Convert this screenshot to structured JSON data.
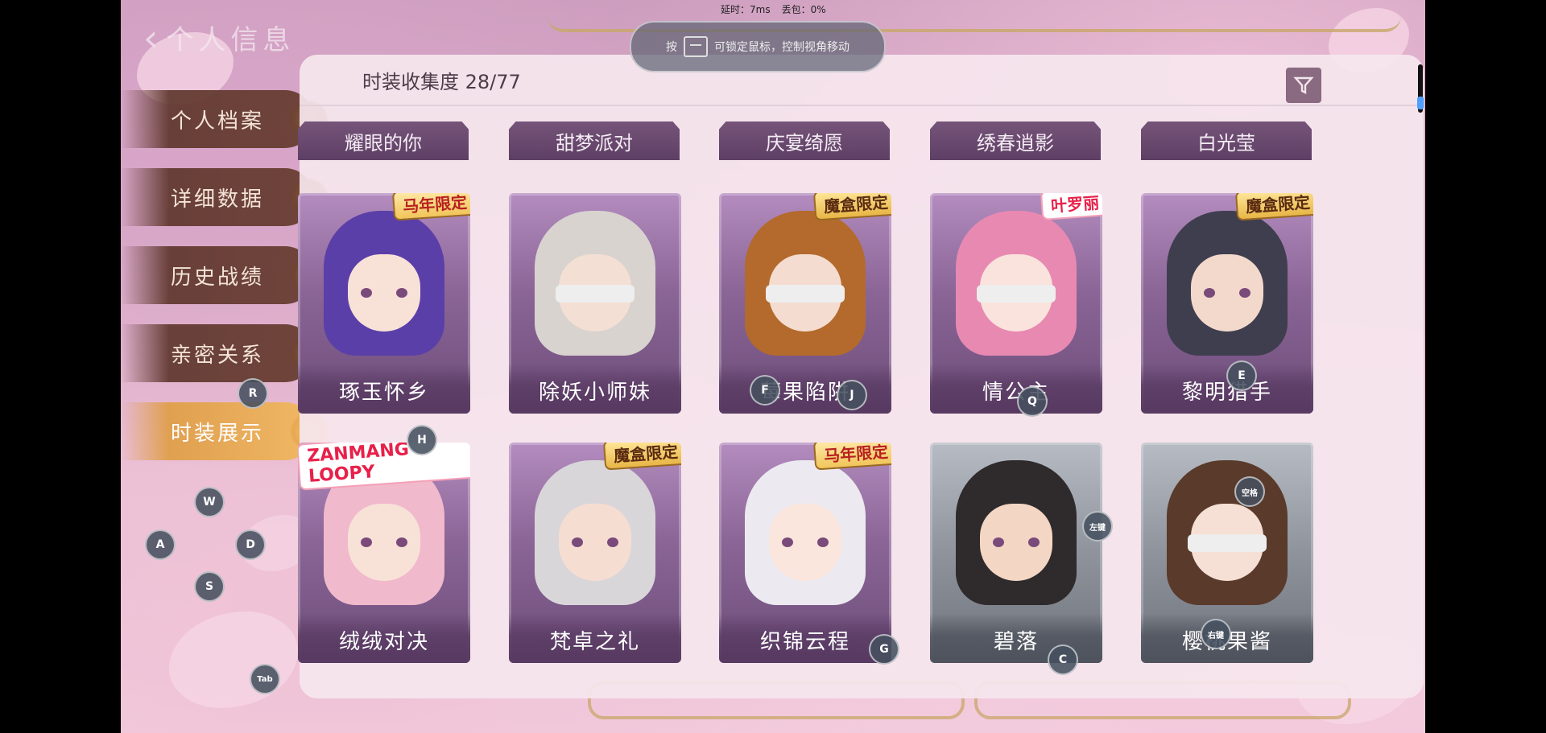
{
  "header": {
    "back_title": "个人信息",
    "net_latency": "延时：7ms",
    "net_loss": "丢包：0%",
    "hint_prefix": "按",
    "hint_text": "可锁定鼠标，控制视角移动"
  },
  "sidebar": {
    "items": [
      {
        "label": "个人档案"
      },
      {
        "label": "详细数据"
      },
      {
        "label": "历史战绩"
      },
      {
        "label": "亲密关系"
      },
      {
        "label": "时装展示",
        "active": true
      }
    ]
  },
  "panel": {
    "collection_label": "时装收集度",
    "collection_value": "28/77",
    "tabs": [
      "耀眼的你",
      "甜梦派对",
      "庆宴绮愿",
      "绣春逍影",
      "白光莹"
    ]
  },
  "costumes": [
    {
      "name": "琢玉怀乡",
      "badge": "马年限定",
      "badge_style": "red",
      "hair": "#5b3fa8",
      "skin": "#f8e2d8"
    },
    {
      "name": "除妖小师妹",
      "badge": "",
      "badge_style": "",
      "hair": "#d8d3cf",
      "skin": "#f4dfd4",
      "blindfold": true
    },
    {
      "name": "莓果陷阱",
      "badge": "魔盒限定",
      "badge_style": "gold",
      "hair": "#b36a2c",
      "skin": "#f4dcd0",
      "blindfold": true
    },
    {
      "name": "情公主",
      "badge": "叶罗丽",
      "badge_style": "pink",
      "hair": "#e889b2",
      "skin": "#fae3dc",
      "blindfold": true
    },
    {
      "name": "黎明猎手",
      "badge": "魔盒限定",
      "badge_style": "gold",
      "hair": "#3f3e4f",
      "skin": "#f3d9cc"
    },
    {
      "name": "绒绒对决",
      "badge": "ZANMANG LOOPY",
      "badge_style": "loopy",
      "hair": "#f1b9cc",
      "skin": "#f8e2d8"
    },
    {
      "name": "梵卓之礼",
      "badge": "魔盒限定",
      "badge_style": "gold",
      "hair": "#d9d6da",
      "skin": "#f6ddd2"
    },
    {
      "name": "织锦云程",
      "badge": "马年限定",
      "badge_style": "red",
      "hair": "#eceaf0",
      "skin": "#fae6dd"
    },
    {
      "name": "碧落",
      "badge": "",
      "badge_style": "",
      "hair": "#2f2a2c",
      "skin": "#f3d6c4",
      "gray": true
    },
    {
      "name": "樱桃果酱",
      "badge": "",
      "badge_style": "",
      "hair": "#5a3a2a",
      "skin": "#f6dfd4",
      "gray": true,
      "blindfold": true
    }
  ],
  "key_overlays": [
    "R",
    "F",
    "J",
    "Q",
    "E",
    "H",
    "W",
    "空格",
    "左键",
    "A",
    "D",
    "S",
    "右键",
    "G",
    "C",
    "Tab"
  ],
  "colors": {
    "accent_gold": "#f0b865",
    "nav_brown": "#6e4432",
    "card_purple": "#8a6596"
  }
}
